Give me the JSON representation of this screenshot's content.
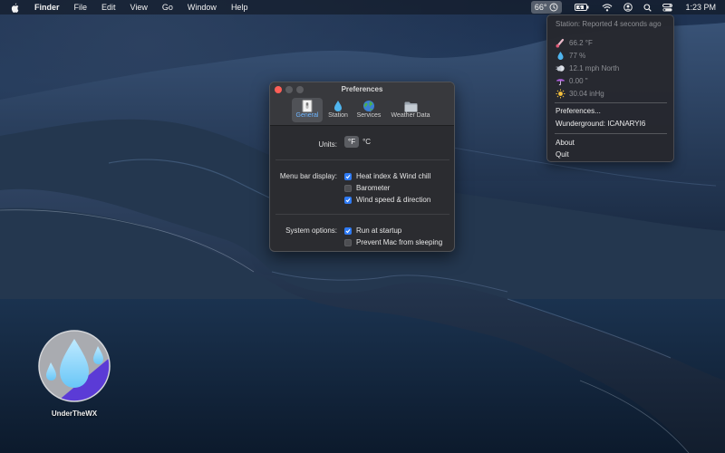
{
  "menubar": {
    "app_name": "Finder",
    "menus": [
      "File",
      "Edit",
      "View",
      "Go",
      "Window",
      "Help"
    ],
    "weather_temp": "66°",
    "clock": "1:23 PM",
    "icons": [
      "apple-icon",
      "weather-status-icon",
      "battery-charging-icon",
      "wifi-icon",
      "user-icon",
      "spotlight-search-icon",
      "control-center-icon"
    ]
  },
  "weather_menu": {
    "station_status": "Station: Reported 4 seconds ago",
    "readings": [
      {
        "icon": "thermometer-icon",
        "value": "66.2 °F"
      },
      {
        "icon": "humidity-drop-icon",
        "value": "77 %"
      },
      {
        "icon": "wind-icon",
        "value": "12.1 mph North"
      },
      {
        "icon": "umbrella-icon",
        "value": "0.00 \""
      },
      {
        "icon": "sun-icon",
        "value": "30.04 inHg"
      }
    ],
    "items": {
      "preferences": "Preferences...",
      "wunderground": "Wunderground: ICANARYI6",
      "about": "About",
      "quit": "Quit"
    }
  },
  "preferences": {
    "title": "Preferences",
    "tabs": [
      {
        "label": "General",
        "icon": "general-switch-icon",
        "selected": true
      },
      {
        "label": "Station",
        "icon": "water-drop-icon",
        "selected": false
      },
      {
        "label": "Services",
        "icon": "globe-icon",
        "selected": false
      },
      {
        "label": "Weather Data",
        "icon": "folder-icon",
        "selected": false
      }
    ],
    "units_label": "Units:",
    "units_options": [
      "°F",
      "°C"
    ],
    "units_selected": "°F",
    "menu_bar_label": "Menu bar display:",
    "menu_bar_options": [
      {
        "label": "Heat index & Wind chill",
        "checked": true
      },
      {
        "label": "Barometer",
        "checked": false
      },
      {
        "label": "Wind speed & direction",
        "checked": true
      }
    ],
    "system_label": "System options:",
    "system_options": [
      {
        "label": "Run at startup",
        "checked": true
      },
      {
        "label": "Prevent Mac from sleeping",
        "checked": false
      }
    ]
  },
  "desktop": {
    "app_icon_label": "UnderTheWX"
  },
  "colors": {
    "accent_blue": "#2f7bf5",
    "close_red": "#fe5f57",
    "window_bg": "#2b2c30",
    "icon_purple": "#5b3bd6",
    "icon_drop_blue": "#8fd8ff"
  }
}
